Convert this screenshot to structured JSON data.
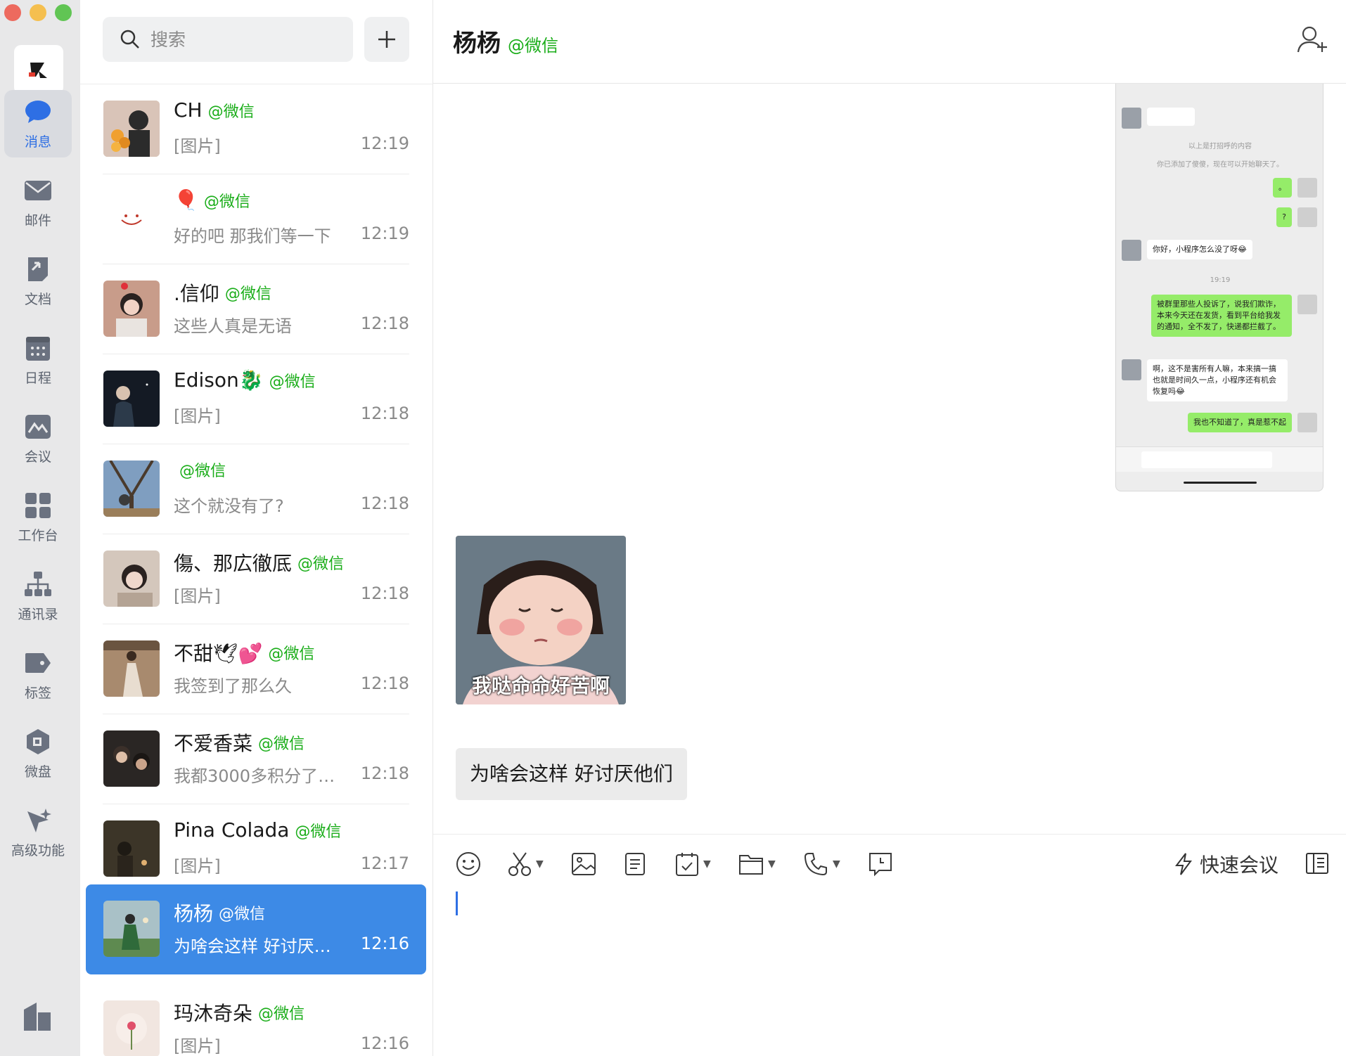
{
  "rail": {
    "items": [
      {
        "key": "messages",
        "label": "消息",
        "icon": "chat-bubble-icon",
        "active": true
      },
      {
        "key": "mail",
        "label": "邮件",
        "icon": "mail-icon",
        "active": false
      },
      {
        "key": "docs",
        "label": "文档",
        "icon": "document-icon",
        "active": false
      },
      {
        "key": "schedule",
        "label": "日程",
        "icon": "calendar-icon",
        "active": false
      },
      {
        "key": "meeting",
        "label": "会议",
        "icon": "meeting-icon",
        "active": false
      },
      {
        "key": "workbench",
        "label": "工作台",
        "icon": "grid-icon",
        "active": false
      },
      {
        "key": "contacts",
        "label": "通讯录",
        "icon": "org-chart-icon",
        "active": false
      },
      {
        "key": "tags",
        "label": "标签",
        "icon": "tag-icon",
        "active": false
      },
      {
        "key": "drive",
        "label": "微盘",
        "icon": "drive-icon",
        "active": false
      },
      {
        "key": "advanced",
        "label": "高级功能",
        "icon": "sparkle-icon",
        "active": false
      }
    ]
  },
  "search": {
    "placeholder": "搜索"
  },
  "conversations": [
    {
      "name": "CH",
      "tag": "@微信",
      "preview": "[图片]",
      "time": "12:19",
      "avatar_color": "#c9a58a"
    },
    {
      "name": "🎈",
      "tag": "@微信",
      "preview": "好的吧 那我们等一下",
      "time": "12:19",
      "avatar_color": "#ffffff"
    },
    {
      "name": ".信仰",
      "tag": "@微信",
      "preview": "这些人真是无语",
      "time": "12:18",
      "avatar_color": "#b08070"
    },
    {
      "name": "Edison🐉",
      "tag": "@微信",
      "preview": "[图片]",
      "time": "12:18",
      "avatar_color": "#1e2430"
    },
    {
      "name": "",
      "tag": "@微信",
      "preview": "这个就没有了?",
      "time": "12:18",
      "avatar_color": "#6f8aa8"
    },
    {
      "name": "傷、那広徹厎",
      "tag": "@微信",
      "preview": "[图片]",
      "time": "12:18",
      "avatar_color": "#a8988c"
    },
    {
      "name": "不甜🕊💕",
      "tag": "@微信",
      "preview": "我签到了那么久",
      "time": "12:18",
      "avatar_color": "#9a7a62"
    },
    {
      "name": "不爱香菜",
      "tag": "@微信",
      "preview": "我都3000多积分了…",
      "time": "12:18",
      "avatar_color": "#3a3330"
    },
    {
      "name": "Pina Colada",
      "tag": "@微信",
      "preview": "[图片]",
      "time": "12:17",
      "avatar_color": "#4a4236"
    },
    {
      "name": "杨杨",
      "tag": "@微信",
      "preview": "为啥会这样 好讨厌…",
      "time": "12:16",
      "avatar_color": "#7aa07a"
    },
    {
      "name": "玛沐奇朵",
      "tag": "@微信",
      "preview": "[图片]",
      "time": "12:16",
      "avatar_color": "#efe3dc"
    }
  ],
  "chat": {
    "title": "杨杨",
    "tag": "@微信",
    "screenshot": {
      "system_1": "以上是打招呼的内容",
      "system_2": "你已添加了傻傻，现在可以开始聊天了。",
      "g1": "。",
      "g2": "?",
      "in1": "你好，小程序怎么没了呀😂",
      "time": "19:19",
      "g3": "被群里那些人投诉了，说我们欺诈，本来今天还在发货，看到平台给我发的通知，全不发了，快递都拦截了。",
      "in2": "啊，这不是害所有人嘛，本来搞一搞也就是时间久一点，小程序还有机会恢复吗😂",
      "g4": "我也不知道了，真是惹不起"
    },
    "sticker_caption": "我哒命命好苦啊",
    "last_message": "为啥会这样 好讨厌他们",
    "quick_meeting": "快速会议"
  }
}
